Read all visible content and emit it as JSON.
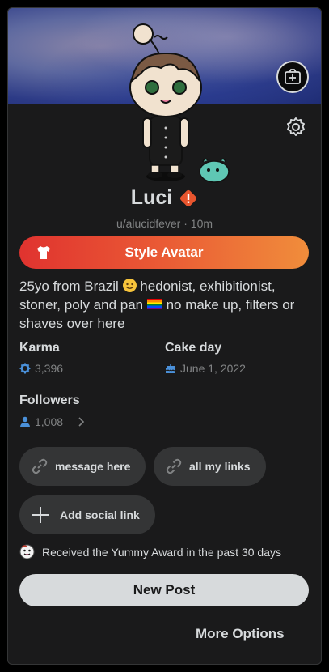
{
  "profile": {
    "display_name": "Luci",
    "handle": "u/alucidfever · 10m",
    "style_avatar_label": "Style Avatar",
    "bio_part1": "25yo from Brazil",
    "bio_part2": " hedonist, exhibitionist, stoner, poly and pan",
    "bio_part3": " no make up, filters or shaves over here"
  },
  "stats": {
    "karma_label": "Karma",
    "karma_value": "3,396",
    "cakeday_label": "Cake day",
    "cakeday_value": "June 1, 2022",
    "followers_label": "Followers",
    "followers_value": "1,008"
  },
  "links": {
    "message_label": "message here",
    "all_links_label": "all my links",
    "add_social_label": "Add social link"
  },
  "award_text": "Received the Yummy Award in the past 30 days",
  "actions": {
    "new_post_label": "New Post",
    "more_options_label": "More Options"
  },
  "colors": {
    "gradient_start": "#e0332f",
    "gradient_end": "#f08d3b",
    "karma_icon": "#4a90d9",
    "warning": "#e8552e"
  },
  "icons": [
    "add-photo-icon",
    "gear-icon",
    "warning-icon",
    "shirt-icon",
    "karma-icon",
    "cake-icon",
    "user-icon",
    "chevron-right-icon",
    "link-icon",
    "plus-icon",
    "award-icon"
  ]
}
